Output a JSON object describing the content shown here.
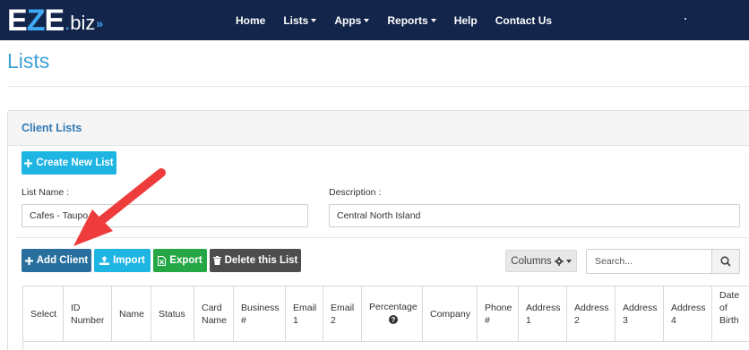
{
  "nav": {
    "logo": {
      "e": "E",
      "z": "Z",
      "e2": "E",
      "dot": ".",
      "biz": "biz",
      "chevrons": "»"
    },
    "items": [
      {
        "label": "Home",
        "dropdown": false
      },
      {
        "label": "Lists",
        "dropdown": true
      },
      {
        "label": "Apps",
        "dropdown": true
      },
      {
        "label": "Reports",
        "dropdown": true
      },
      {
        "label": "Help",
        "dropdown": false
      },
      {
        "label": "Contact Us",
        "dropdown": false
      }
    ]
  },
  "page": {
    "title": "Lists"
  },
  "panel": {
    "title": "Client Lists",
    "create_button": "Create New List",
    "list_name_label": "List Name :",
    "list_name_value": "Cafes - Taupo",
    "description_label": "Description :",
    "description_value": "Central North Island"
  },
  "toolbar": {
    "add_client": "Add Client",
    "import": "Import",
    "export": "Export",
    "delete_list": "Delete this List",
    "columns": "Columns",
    "search_placeholder": "Search..."
  },
  "table": {
    "headers": [
      {
        "line1": "Select",
        "line2": "",
        "line3": ""
      },
      {
        "line1": "ID",
        "line2": "Number",
        "line3": ""
      },
      {
        "line1": "Name",
        "line2": "",
        "line3": ""
      },
      {
        "line1": "Status",
        "line2": "",
        "line3": ""
      },
      {
        "line1": "Card",
        "line2": "Name",
        "line3": ""
      },
      {
        "line1": "Business",
        "line2": "#",
        "line3": ""
      },
      {
        "line1": "Email",
        "line2": "1",
        "line3": ""
      },
      {
        "line1": "Email",
        "line2": "2",
        "line3": ""
      },
      {
        "line1": "Percentage",
        "line2": "",
        "line3": ""
      },
      {
        "line1": "Company",
        "line2": "",
        "line3": ""
      },
      {
        "line1": "Phone",
        "line2": "#",
        "line3": ""
      },
      {
        "line1": "Address",
        "line2": "1",
        "line3": ""
      },
      {
        "line1": "Address",
        "line2": "2",
        "line3": ""
      },
      {
        "line1": "Address",
        "line2": "3",
        "line3": ""
      },
      {
        "line1": "Address",
        "line2": "4",
        "line3": ""
      },
      {
        "line1": "Date",
        "line2": "of",
        "line3": "Birth"
      }
    ]
  },
  "colors": {
    "navbar": "#13254a",
    "brand_blue": "#3fa9f5",
    "title_blue": "#3ea1d6",
    "annotation_arrow": "#ee3b3b"
  },
  "icons": {
    "create": "plus-icon",
    "add_client": "plus-icon",
    "import": "upload-icon",
    "export": "file-excel-icon",
    "delete": "trash-icon",
    "columns": "gear-icon",
    "search": "search-icon",
    "percentage_help": "question-circle-icon",
    "annotation": "red-arrow"
  }
}
